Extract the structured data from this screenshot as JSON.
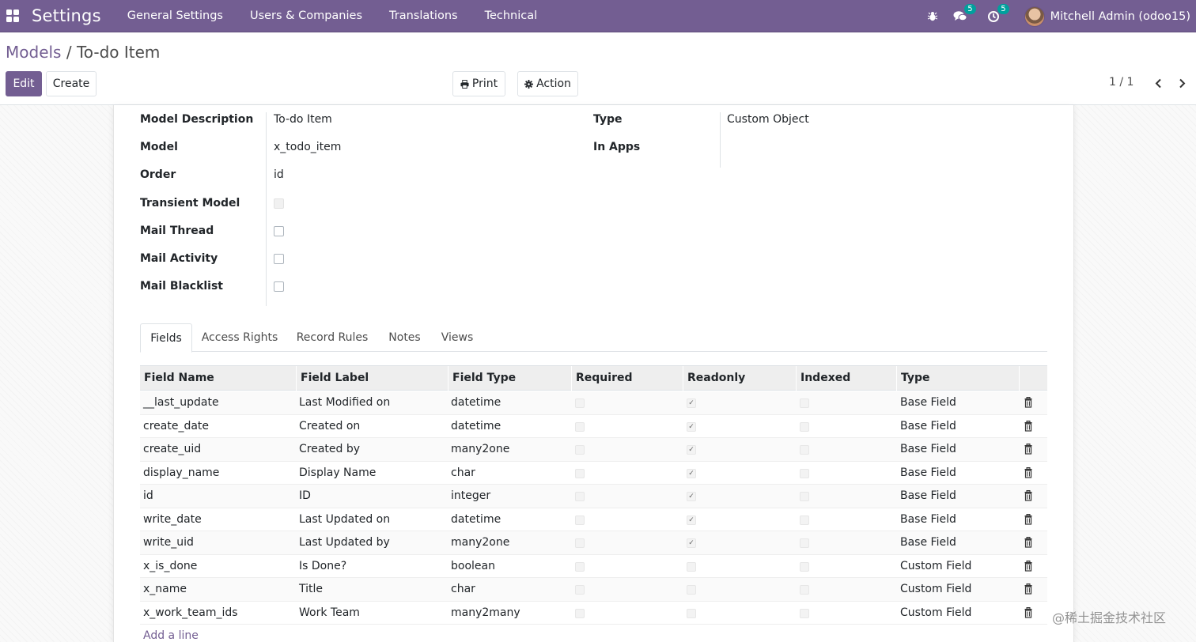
{
  "navbar": {
    "app_name": "Settings",
    "menu": [
      "General Settings",
      "Users & Companies",
      "Translations",
      "Technical"
    ],
    "messages_badge": "5",
    "activities_badge": "5",
    "user": "Mitchell Admin (odoo15)"
  },
  "breadcrumb": {
    "parent": "Models",
    "separator": "/",
    "current": "To-do Item"
  },
  "buttons": {
    "edit": "Edit",
    "create": "Create",
    "print": "Print",
    "action": "Action"
  },
  "pager": {
    "value": "1 / 1"
  },
  "form": {
    "model_description": {
      "label": "Model Description",
      "value": "To-do Item"
    },
    "model": {
      "label": "Model",
      "value": "x_todo_item"
    },
    "order": {
      "label": "Order",
      "value": "id"
    },
    "transient_model": {
      "label": "Transient Model",
      "checked": false
    },
    "mail_thread": {
      "label": "Mail Thread",
      "checked": false
    },
    "mail_activity": {
      "label": "Mail Activity",
      "checked": false
    },
    "mail_blacklist": {
      "label": "Mail Blacklist",
      "checked": false
    },
    "type": {
      "label": "Type",
      "value": "Custom Object"
    },
    "in_apps": {
      "label": "In Apps",
      "value": ""
    }
  },
  "tabs": [
    "Fields",
    "Access Rights",
    "Record Rules",
    "Notes",
    "Views"
  ],
  "fields_table": {
    "columns": [
      "Field Name",
      "Field Label",
      "Field Type",
      "Required",
      "Readonly",
      "Indexed",
      "Type"
    ],
    "rows": [
      {
        "name": "__last_update",
        "label": "Last Modified on",
        "ftype": "datetime",
        "required": false,
        "readonly": true,
        "indexed": false,
        "type": "Base Field"
      },
      {
        "name": "create_date",
        "label": "Created on",
        "ftype": "datetime",
        "required": false,
        "readonly": true,
        "indexed": false,
        "type": "Base Field"
      },
      {
        "name": "create_uid",
        "label": "Created by",
        "ftype": "many2one",
        "required": false,
        "readonly": true,
        "indexed": false,
        "type": "Base Field"
      },
      {
        "name": "display_name",
        "label": "Display Name",
        "ftype": "char",
        "required": false,
        "readonly": true,
        "indexed": false,
        "type": "Base Field"
      },
      {
        "name": "id",
        "label": "ID",
        "ftype": "integer",
        "required": false,
        "readonly": true,
        "indexed": false,
        "type": "Base Field"
      },
      {
        "name": "write_date",
        "label": "Last Updated on",
        "ftype": "datetime",
        "required": false,
        "readonly": true,
        "indexed": false,
        "type": "Base Field"
      },
      {
        "name": "write_uid",
        "label": "Last Updated by",
        "ftype": "many2one",
        "required": false,
        "readonly": true,
        "indexed": false,
        "type": "Base Field"
      },
      {
        "name": "x_is_done",
        "label": "Is Done?",
        "ftype": "boolean",
        "required": false,
        "readonly": false,
        "indexed": false,
        "type": "Custom Field"
      },
      {
        "name": "x_name",
        "label": "Title",
        "ftype": "char",
        "required": false,
        "readonly": false,
        "indexed": false,
        "type": "Custom Field"
      },
      {
        "name": "x_work_team_ids",
        "label": "Work Team",
        "ftype": "many2many",
        "required": false,
        "readonly": false,
        "indexed": false,
        "type": "Custom Field"
      }
    ],
    "add_line": "Add a line"
  },
  "watermark": "@稀土掘金技术社区",
  "colors": {
    "brand": "#735e92",
    "badge": "#00a09d"
  }
}
